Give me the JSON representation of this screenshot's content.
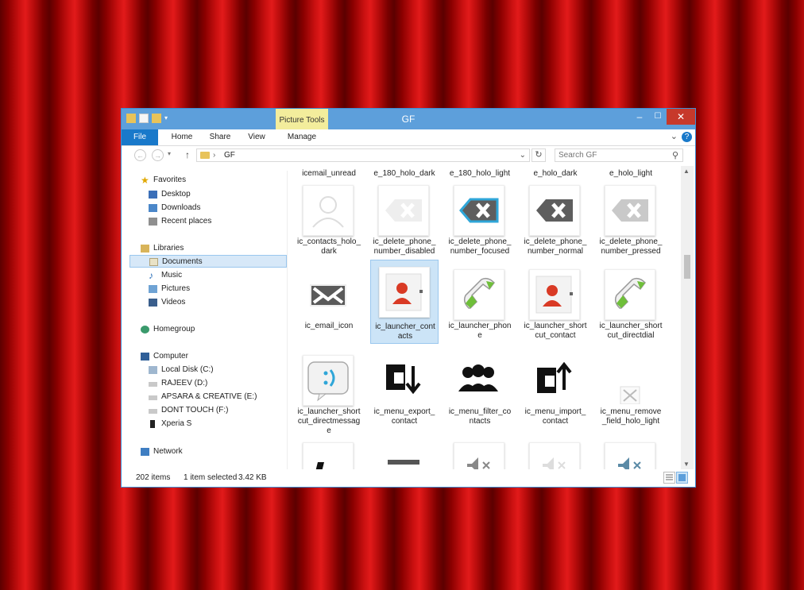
{
  "window": {
    "title": "GF",
    "contextual_tab": "Picture Tools",
    "controls": {
      "minimize": "–",
      "maximize": "☐",
      "close": "✕"
    }
  },
  "ribbon": {
    "tabs": [
      "File",
      "Home",
      "Share",
      "View",
      "Manage"
    ]
  },
  "address": {
    "path": "GF",
    "separator": "›",
    "search_placeholder": "Search GF"
  },
  "nav": {
    "favorites": "Favorites",
    "desktop": "Desktop",
    "downloads": "Downloads",
    "recent": "Recent places",
    "libraries": "Libraries",
    "documents": "Documents",
    "music": "Music",
    "pictures": "Pictures",
    "videos": "Videos",
    "homegroup": "Homegroup",
    "computer": "Computer",
    "local_disk": "Local Disk (C:)",
    "rajeev": "RAJEEV (D:)",
    "apsara": "APSARA & CREATIVE (E:)",
    "dont_touch": "DONT TOUCH (F:)",
    "xperia": "Xperia S",
    "network": "Network"
  },
  "files": {
    "top_partial": [
      "icemail_unread",
      "e_180_holo_dark",
      "e_180_holo_light",
      "e_holo_dark",
      "e_holo_light"
    ],
    "row1": [
      "ic_contacts_holo_\ndark",
      "ic_delete_phone_\nnumber_disabled",
      "ic_delete_phone_\nnumber_focused",
      "ic_delete_phone_\nnumber_normal",
      "ic_delete_phone_\nnumber_pressed"
    ],
    "row2": [
      "ic_email_icon",
      "ic_launcher_cont\nacts",
      "ic_launcher_phon\ne",
      "ic_launcher_short\ncut_contact",
      "ic_launcher_short\ncut_directdial"
    ],
    "row3": [
      "ic_launcher_short\ncut_directmessag\ne",
      "ic_menu_export_\ncontact",
      "ic_menu_filter_co\nntacts",
      "ic_menu_import_\ncontact",
      "ic_menu_remove\n_field_holo_light"
    ]
  },
  "status": {
    "count": "202 items",
    "selection": "1 item selected",
    "size": "3.42 KB"
  },
  "colors": {
    "accent": "#1979ca",
    "titlebar": "#5d9fdb",
    "close": "#c7392b",
    "selection": "#cce4f7"
  }
}
